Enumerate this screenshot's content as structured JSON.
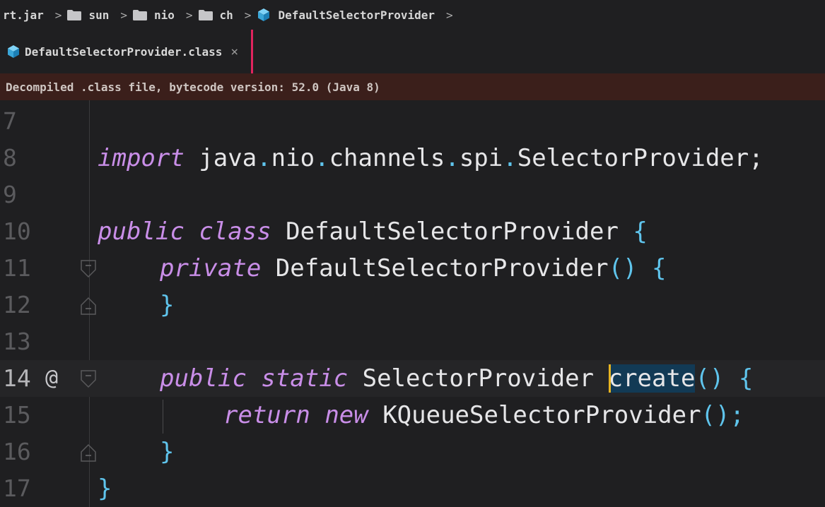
{
  "breadcrumb": {
    "root": "rt.jar",
    "items": [
      {
        "label": "sun",
        "icon": "folder-icon"
      },
      {
        "label": "nio",
        "icon": "folder-icon"
      },
      {
        "label": "ch",
        "icon": "folder-icon"
      },
      {
        "label": "DefaultSelectorProvider",
        "icon": "class-cube-icon"
      }
    ]
  },
  "tab": {
    "label": "DefaultSelectorProvider.class",
    "close": "×",
    "accent": "#e0245e"
  },
  "banner": {
    "text": "Decompiled .class file, bytecode version: 52.0 (Java 8)"
  },
  "editor": {
    "lines": [
      {
        "number": "7"
      },
      {
        "number": "8",
        "tokens": [
          "import",
          " java",
          ".",
          "nio",
          ".",
          "channels",
          ".",
          "spi",
          ".",
          "SelectorProvider;"
        ]
      },
      {
        "number": "9"
      },
      {
        "number": "10",
        "tokens": [
          "public",
          " ",
          "class",
          " DefaultSelectorProvider ",
          "{"
        ]
      },
      {
        "number": "11",
        "tokens": [
          "private",
          " DefaultSelectorProvider",
          "()",
          " ",
          "{"
        ]
      },
      {
        "number": "12",
        "tokens": [
          "}"
        ]
      },
      {
        "number": "13"
      },
      {
        "number": "14",
        "marker": "@",
        "tokens": [
          "public",
          " ",
          "static",
          " SelectorProvider ",
          "create",
          "()",
          " ",
          "{"
        ]
      },
      {
        "number": "15",
        "tokens": [
          "return",
          " ",
          "new",
          " KQueueSelectorProvider",
          "();"
        ]
      },
      {
        "number": "16",
        "tokens": [
          "}"
        ]
      },
      {
        "number": "17",
        "tokens": [
          "}"
        ]
      }
    ]
  },
  "colors": {
    "keyword": "#c98ee8",
    "punctuation": "#5fc4ec",
    "identifier": "#e6e6e8",
    "banner_bg": "#3b1f1b",
    "caret": "#e6b422",
    "selection": "#123a55"
  }
}
